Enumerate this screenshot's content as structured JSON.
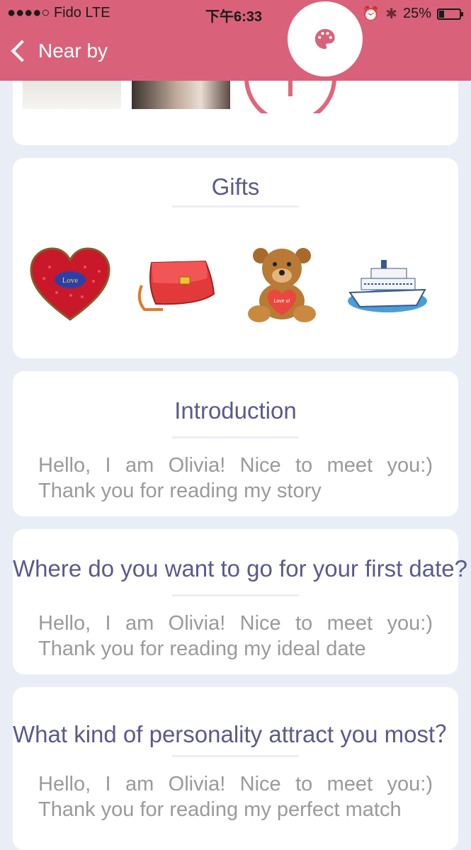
{
  "status_bar": {
    "carrier": "●●●●○ Fido  LTE",
    "time": "下午6:33",
    "battery": "25%",
    "battery_level": 0.25
  },
  "nav": {
    "back_label": "Near by"
  },
  "fab": {
    "icon": "palette-icon"
  },
  "gifts": {
    "title": "Gifts",
    "items": [
      {
        "name": "heart-gift",
        "label": "Love"
      },
      {
        "name": "handbag-gift"
      },
      {
        "name": "teddy-bear-gift",
        "label": "Love u!"
      },
      {
        "name": "cruise-ship-gift"
      }
    ]
  },
  "introduction": {
    "title": "Introduction",
    "body": "Hello, I am Olivia! Nice to meet you:) Thank you for reading my story"
  },
  "first_date": {
    "title": "Where do you want to go for your first date?",
    "body": "Hello, I am Olivia! Nice to meet you:) Thank you for reading my ideal date"
  },
  "personality": {
    "title": "What kind of personality attract you most？",
    "body": "Hello, I am Olivia! Nice to meet you:) Thank you for reading my perfect match"
  },
  "colors": {
    "accent": "#d9627a",
    "title_text": "#5b5a8c",
    "body_text": "#9a9a9a",
    "background": "#e9edf5"
  }
}
